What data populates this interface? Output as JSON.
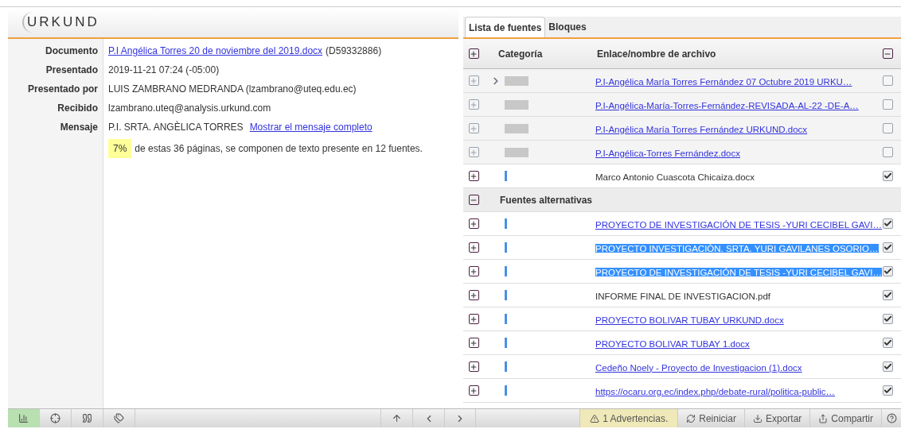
{
  "logo": {
    "text": "URKUND"
  },
  "details": [
    {
      "label": "Documento",
      "value": "P.I Angélica Torres 20 de noviembre del 2019.docx",
      "kind": "link",
      "extra": "(D59332886)"
    },
    {
      "label": "Presentado",
      "value": "2019-11-21 07:24 (-05:00)",
      "kind": "text"
    },
    {
      "label": "Presentado por",
      "value": "LUIS ZAMBRANO MEDRANDA (lzambrano@uteq.edu.ec)",
      "kind": "text"
    },
    {
      "label": "Recibido",
      "value": "lzambrano.uteq@analysis.urkund.com",
      "kind": "text"
    },
    {
      "label": "Mensaje",
      "value": "P.I. SRTA. ANGÈLICA TORRES",
      "kind": "text",
      "link": "Mostrar el mensaje completo"
    }
  ],
  "summary": {
    "percent": "7%",
    "text": "de estas 36 páginas, se componen de texto presente en 12 fuentes."
  },
  "tabs": [
    {
      "label": "Lista de fuentes",
      "selected": true
    },
    {
      "label": "Bloques",
      "selected": false
    }
  ],
  "table": {
    "columns": [
      "Categoría",
      "Enlace/nombre de archivo"
    ],
    "rows": [
      {
        "kind": "source",
        "name": "P.I-Angélica María Torres Fernández 07 Octubre 2019 URKU…",
        "link": true,
        "dimmed": true,
        "chevron": true,
        "selected": false,
        "checked": false
      },
      {
        "kind": "source",
        "name": "P.I-Angélica-María-Torres-Fernández-REVISADA-AL-22 -DE-A…",
        "link": true,
        "dimmed": true,
        "chevron": false,
        "selected": false,
        "checked": false
      },
      {
        "kind": "source",
        "name": "P.I-Angélica María Torres Fernández URKUND.docx",
        "link": true,
        "dimmed": true,
        "chevron": false,
        "selected": false,
        "checked": false
      },
      {
        "kind": "source",
        "name": "P.I-Angélica-Torres Fernández.docx",
        "link": true,
        "dimmed": true,
        "chevron": false,
        "selected": false,
        "checked": false
      },
      {
        "kind": "source",
        "name": "Marco Antonio Cuascota Chicaiza.docx",
        "link": false,
        "dimmed": false,
        "chevron": false,
        "selected": false,
        "checked": true
      },
      {
        "kind": "group",
        "name": "Fuentes alternativas",
        "expanded": true
      },
      {
        "kind": "source",
        "name": "PROYECTO DE INVESTIGACIÓN DE TESIS -YURI CECIBEL GAVI…",
        "link": true,
        "dimmed": false,
        "chevron": false,
        "selected": false,
        "checked": true
      },
      {
        "kind": "source",
        "name": "PROYECTO INVESTIGACIÒN. SRTA. YURI GAVILANES OSORIO…",
        "link": true,
        "dimmed": false,
        "chevron": false,
        "selected": true,
        "checked": true
      },
      {
        "kind": "source",
        "name": "PROYECTO DE INVESTIGACIÓN DE TESIS -YURI CECIBEL GAVI…",
        "link": true,
        "dimmed": false,
        "chevron": false,
        "selected": true,
        "checked": true
      },
      {
        "kind": "source",
        "name": "INFORME FINAL DE INVESTIGACION.pdf",
        "link": false,
        "dimmed": false,
        "chevron": false,
        "selected": false,
        "checked": true
      },
      {
        "kind": "source",
        "name": "PROYECTO BOLIVAR TUBAY URKUND.docx",
        "link": true,
        "dimmed": false,
        "chevron": false,
        "selected": false,
        "checked": true
      },
      {
        "kind": "source",
        "name": "PROYECTO BOLIVAR TUBAY 1.docx",
        "link": true,
        "dimmed": false,
        "chevron": false,
        "selected": false,
        "checked": true
      },
      {
        "kind": "source",
        "name": "Cedeño Noely - Proyecto de Investigacion (1).docx",
        "link": true,
        "dimmed": false,
        "chevron": false,
        "selected": false,
        "checked": true
      },
      {
        "kind": "source",
        "name": "https://ocaru.org.ec/index.php/debate-rural/politica-public…",
        "link": true,
        "dimmed": false,
        "chevron": false,
        "selected": false,
        "checked": true
      }
    ]
  },
  "toolbar": {
    "left": [
      {
        "kind": "chart",
        "selected": true
      },
      {
        "kind": "target",
        "selected": false
      },
      {
        "kind": "quote",
        "selected": false
      },
      {
        "kind": "tag",
        "selected": false
      }
    ],
    "warning": "1 Advertencias.",
    "buttons": [
      {
        "kind": "refresh",
        "label": "Reiniciar"
      },
      {
        "kind": "download",
        "label": "Exportar"
      },
      {
        "kind": "share",
        "label": "Compartir"
      }
    ]
  }
}
